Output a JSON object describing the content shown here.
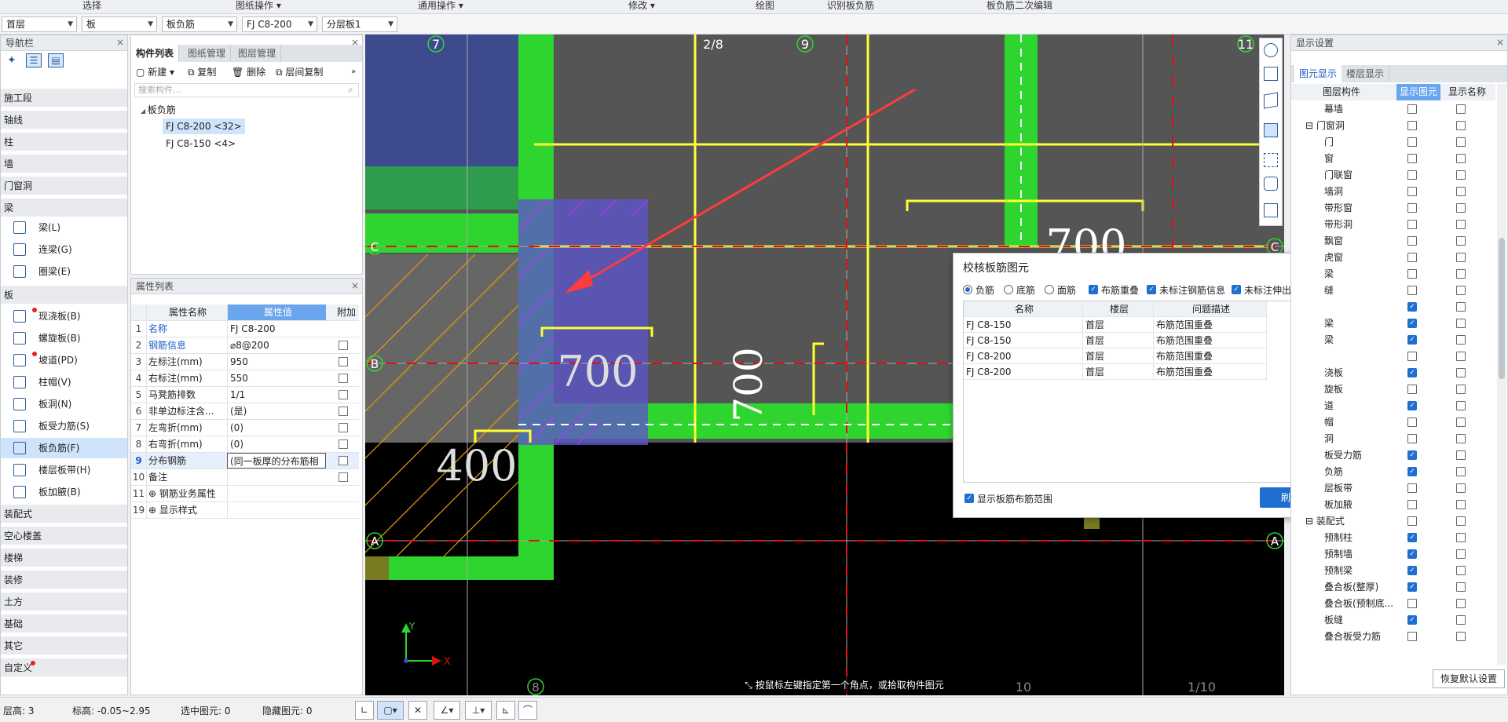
{
  "topbar": {
    "items": [
      "选择",
      "图纸操作 ▾",
      "通用操作 ▾",
      "修改 ▾",
      "绘图",
      "识别板负筋",
      "板负筋二次编辑"
    ]
  },
  "selectors": {
    "floor": "首层",
    "category": "板",
    "type": "板负筋",
    "name": "FJ C8-200",
    "layer": "分层板1"
  },
  "nav": {
    "title": "导航栏",
    "cats": [
      "施工段",
      "轴线",
      "柱",
      "墙",
      "门窗洞",
      "梁"
    ],
    "beam_items": [
      "梁(L)",
      "连梁(G)",
      "圈梁(E)"
    ],
    "slab_cat": "板",
    "slab_items": [
      "现浇板(B)",
      "螺旋板(B)",
      "坡道(PD)",
      "柱帽(V)",
      "板洞(N)",
      "板受力筋(S)",
      "板负筋(F)",
      "楼层板带(H)",
      "板加腋(B)"
    ],
    "bottom_cats": [
      "装配式",
      "空心楼盖",
      "楼梯",
      "装修",
      "土方",
      "基础",
      "其它",
      "自定义"
    ]
  },
  "complist": {
    "tabs": [
      "构件列表",
      "图纸管理",
      "图层管理"
    ],
    "toolbar": [
      "新建 ▾",
      "复制",
      "删除",
      "层间复制"
    ],
    "search_placeholder": "搜索构件...",
    "tree_root": "板负筋",
    "items": [
      "FJ C8-200 <32>",
      "FJ C8-150 <4>"
    ]
  },
  "props": {
    "title": "属性列表",
    "headers": [
      "属性名称",
      "属性值",
      "附加"
    ],
    "rows": [
      {
        "n": "1",
        "k": "名称",
        "v": "FJ C8-200"
      },
      {
        "n": "2",
        "k": "钢筋信息",
        "v": "⌀8@200"
      },
      {
        "n": "3",
        "k": "左标注(mm)",
        "v": "950"
      },
      {
        "n": "4",
        "k": "右标注(mm)",
        "v": "550"
      },
      {
        "n": "5",
        "k": "马凳筋排数",
        "v": "1/1"
      },
      {
        "n": "6",
        "k": "非单边标注含...",
        "v": "(是)"
      },
      {
        "n": "7",
        "k": "左弯折(mm)",
        "v": "(0)"
      },
      {
        "n": "8",
        "k": "右弯折(mm)",
        "v": "(0)"
      },
      {
        "n": "9",
        "k": "分布钢筋",
        "v": "(同一板厚的分布筋相"
      },
      {
        "n": "10",
        "k": "备注",
        "v": ""
      },
      {
        "n": "11",
        "k": "⊕ 钢筋业务属性",
        "v": ""
      },
      {
        "n": "19",
        "k": "⊕ 显示样式",
        "v": ""
      }
    ]
  },
  "canvas": {
    "axis_labels": [
      "7",
      "2/8",
      "9",
      "11",
      "C",
      "B",
      "A",
      "A",
      "C",
      "8",
      "10",
      "1/10"
    ],
    "dims": [
      "700",
      "700",
      "700",
      "400"
    ],
    "hint": "按鼠标左键指定第一个角点，或拾取构件图元",
    "ucs": [
      "Y",
      "X"
    ]
  },
  "dialog": {
    "title": "校核板筋图元",
    "radios": [
      "负筋",
      "底筋",
      "面筋"
    ],
    "checks": [
      "布筋重叠",
      "未标注钢筋信息",
      "未标注伸出长度"
    ],
    "headers": [
      "名称",
      "楼层",
      "问题描述"
    ],
    "rows": [
      [
        "FJ C8-150",
        "首层",
        "布筋范围重叠"
      ],
      [
        "FJ C8-150",
        "首层",
        "布筋范围重叠"
      ],
      [
        "FJ C8-200",
        "首层",
        "布筋范围重叠"
      ],
      [
        "FJ C8-200",
        "首层",
        "布筋范围重叠"
      ]
    ],
    "show_range": "显示板筋布筋范围",
    "refresh": "刷新"
  },
  "display": {
    "title": "显示设置",
    "tabs": [
      "图元显示",
      "楼层显示"
    ],
    "headers": [
      "图层构件",
      "显示图元",
      "显示名称"
    ],
    "rows": [
      {
        "label": "幕墙",
        "c1": false,
        "c2": false
      },
      {
        "label": "⊟ 门窗洞",
        "c1": false,
        "c2": false
      },
      {
        "label": "门",
        "c1": false,
        "c2": false
      },
      {
        "label": "窗",
        "c1": false,
        "c2": false
      },
      {
        "label": "门联窗",
        "c1": false,
        "c2": false
      },
      {
        "label": "墙洞",
        "c1": false,
        "c2": false
      },
      {
        "label": "带形窗",
        "c1": false,
        "c2": false
      },
      {
        "label": "带形洞",
        "c1": false,
        "c2": false
      },
      {
        "label": "飘窗",
        "c1": false,
        "c2": false
      },
      {
        "label": "虎窗",
        "c1": false,
        "c2": false
      },
      {
        "label": "梁",
        "c1": false,
        "c2": false
      },
      {
        "label": "缝",
        "c1": false,
        "c2": false
      },
      {
        "label": "",
        "c1": true,
        "c2": false
      },
      {
        "label": "梁",
        "c1": true,
        "c2": false
      },
      {
        "label": "梁",
        "c1": true,
        "c2": false
      },
      {
        "label": "",
        "c1": false,
        "c2": false
      },
      {
        "label": "浇板",
        "c1": true,
        "c2": false
      },
      {
        "label": "旋板",
        "c1": false,
        "c2": false
      },
      {
        "label": "道",
        "c1": true,
        "c2": false
      },
      {
        "label": "帽",
        "c1": false,
        "c2": false
      },
      {
        "label": "洞",
        "c1": false,
        "c2": false
      },
      {
        "label": "板受力筋",
        "c1": true,
        "c2": false
      },
      {
        "label": "负筋",
        "c1": true,
        "c2": false
      },
      {
        "label": "层板带",
        "c1": false,
        "c2": false
      },
      {
        "label": "板加腋",
        "c1": false,
        "c2": false
      },
      {
        "label": "⊟ 装配式",
        "c1": false,
        "c2": false
      },
      {
        "label": "预制柱",
        "c1": true,
        "c2": false
      },
      {
        "label": "预制墙",
        "c1": true,
        "c2": false
      },
      {
        "label": "预制梁",
        "c1": true,
        "c2": false
      },
      {
        "label": "叠合板(整厚)",
        "c1": true,
        "c2": false
      },
      {
        "label": "叠合板(预制底...",
        "c1": false,
        "c2": false
      },
      {
        "label": "板缝",
        "c1": true,
        "c2": false
      },
      {
        "label": "叠合板受力筋",
        "c1": false,
        "c2": false
      }
    ],
    "restore": "恢复默认设置"
  },
  "status": {
    "floor_h": "层高: 3",
    "elev": "标高: -0.05~2.95",
    "selected": "选中图元: 0",
    "hidden": "隐藏图元: 0"
  }
}
